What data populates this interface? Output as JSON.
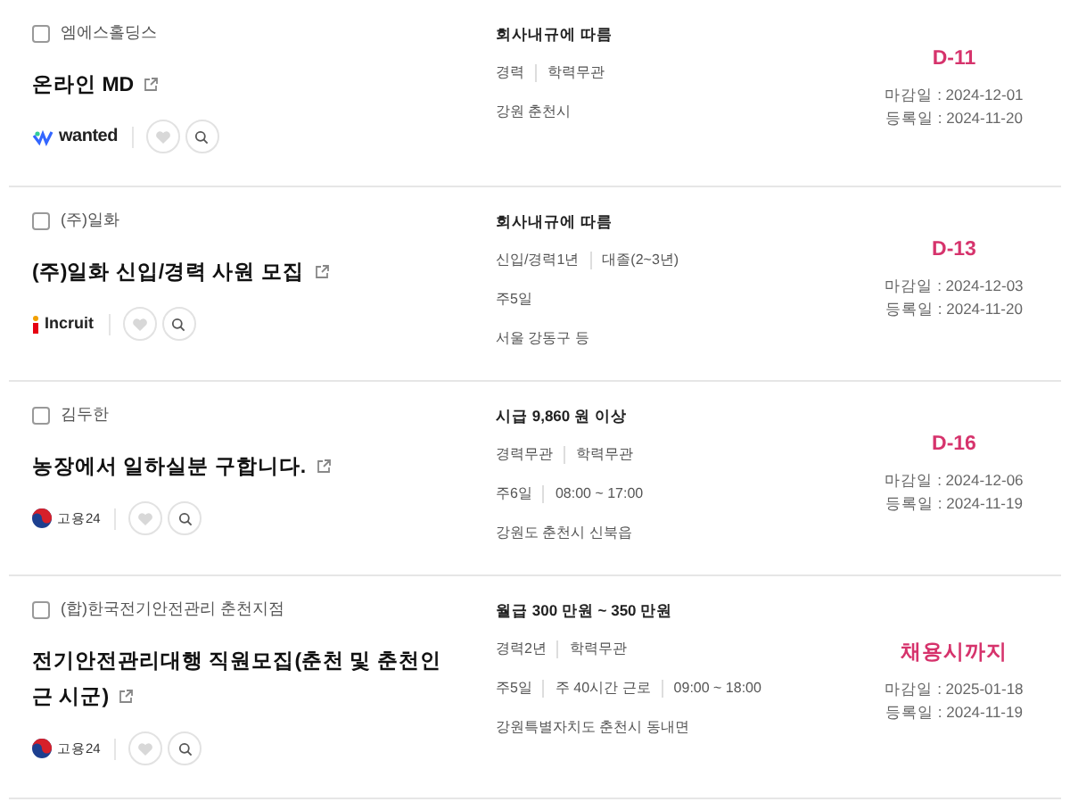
{
  "jobs": [
    {
      "company": "엠에스홀딩스",
      "checked": false,
      "title": "온라인 MD",
      "source": {
        "kind": "wanted",
        "label": "wanted"
      },
      "salary": "회사내규에 따름",
      "details": [
        [
          "경력",
          "학력무관"
        ],
        [
          "강원 춘천시"
        ]
      ],
      "deadline_label": "D-11",
      "deadline": "마감일 : 2024-12-01",
      "registered": "등록일 : 2024-11-20"
    },
    {
      "company": "(주)일화",
      "checked": false,
      "title": "(주)일화 신입/경력 사원 모집",
      "source": {
        "kind": "incruit",
        "label": "Incruit"
      },
      "salary": "회사내규에 따름",
      "details": [
        [
          "신입/경력1년",
          "대졸(2~3년)"
        ],
        [
          "주5일"
        ],
        [
          "서울 강동구 등"
        ]
      ],
      "deadline_label": "D-13",
      "deadline": "마감일 : 2024-12-03",
      "registered": "등록일 : 2024-11-20"
    },
    {
      "company": "김두한",
      "checked": false,
      "title": "농장에서 일하실분 구합니다.",
      "source": {
        "kind": "work24",
        "label": "고용24"
      },
      "salary": "시급 9,860 원 이상",
      "details": [
        [
          "경력무관",
          "학력무관"
        ],
        [
          "주6일",
          "08:00 ~ 17:00"
        ],
        [
          "강원도 춘천시 신북읍"
        ]
      ],
      "deadline_label": "D-16",
      "deadline": "마감일 : 2024-12-06",
      "registered": "등록일 : 2024-11-19"
    },
    {
      "company": "(합)한국전기안전관리 춘천지점",
      "checked": false,
      "title": "전기안전관리대행 직원모집(춘천 및 춘천인근 시군)",
      "source": {
        "kind": "work24",
        "label": "고용24"
      },
      "salary": "월급 300 만원 ~ 350 만원",
      "details": [
        [
          "경력2년",
          "학력무관"
        ],
        [
          "주5일",
          "주 40시간 근로",
          "09:00 ~ 18:00"
        ],
        [
          "강원특별자치도 춘천시 동내면"
        ]
      ],
      "deadline_label": "채용시까지",
      "deadline": "마감일 : 2025-01-18",
      "registered": "등록일 : 2024-11-19"
    }
  ]
}
